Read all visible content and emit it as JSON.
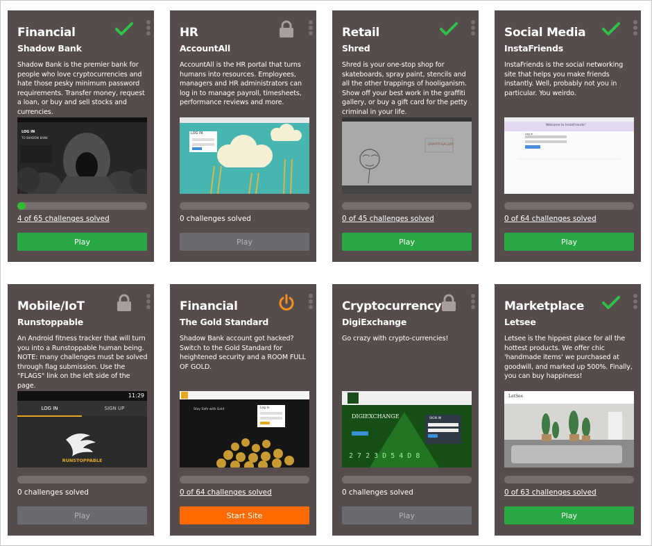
{
  "colors": {
    "card_bg": "#564c4c",
    "play": "#27a844",
    "disabled": "#6a6b70",
    "start": "#ff6a00",
    "check": "#2ec24a",
    "lock": "#a99e9e",
    "power": "#f5901e"
  },
  "cards": [
    {
      "category": "Financial",
      "name": "Shadow Bank",
      "description": "Shadow Bank is the premier bank for people who love cryptocurrencies and hate those pesky minimum password requirements. Transfer money, request a loan, or buy and sell stocks and currencies.",
      "status_icon": "check-icon",
      "progress": 0.06,
      "solved_text": "4 of 65 challenges solved",
      "button": "Play",
      "button_state": "play",
      "shot_caption": "LOG IN",
      "shot_sub": "TO SHADOW BANK"
    },
    {
      "category": "HR",
      "name": "AccountAll",
      "description": "AccountAll is the HR portal that turns humans into resources. Employees, managers and HR administrators can log in to manage payroll, timesheets, performance reviews and more.",
      "status_icon": "lock-icon",
      "progress": 0,
      "solved_text": "0 challenges solved",
      "button": "Play",
      "button_state": "disabled",
      "shot_caption": "LOG IN"
    },
    {
      "category": "Retail",
      "name": "Shred",
      "description": "Shred is your one-stop shop for skateboards, spray paint, stencils and all the other trappings of hooliganism. Show off your best work in the graffiti gallery, or buy a gift card for the petty criminal in your life.",
      "status_icon": "check-icon",
      "progress": 0,
      "solved_text": "0 of 45 challenges solved",
      "button": "Play",
      "button_state": "play",
      "shot_caption": "GRAFFITI GALLERY"
    },
    {
      "category": "Social Media",
      "name": "InstaFriends",
      "description": "InstaFriends is the social networking site that helps you make friends instantly. Well, probably not you in particular. You weirdo.",
      "status_icon": "check-icon",
      "progress": 0,
      "solved_text": "0 of 64 challenges solved",
      "button": "Play",
      "button_state": "play",
      "shot_caption": "Welcome to InstaFriends!",
      "shot_sub": "Log in"
    },
    {
      "category": "Mobile/IoT",
      "name": "Runstoppable",
      "description": "An Android fitness tracker that will turn you into a Runstoppable human being. NOTE: many challenges must be solved through flag submission. Use the \"FLAGS\" link on the left side of the page.",
      "status_icon": "lock-icon",
      "progress": 0,
      "solved_text": "0 challenges solved",
      "button": "Play",
      "button_state": "disabled",
      "shot_time": "11:29",
      "shot_tab1": "LOG IN",
      "shot_tab2": "SIGN UP",
      "shot_caption": "RUNSTOPPABLE"
    },
    {
      "category": "Financial",
      "name": "The Gold Standard",
      "description": "Shadow Bank account got hacked? Switch to the Gold Standard for heightened security and a ROOM FULL OF GOLD.",
      "status_icon": "power-icon",
      "progress": 0,
      "solved_text": "0 of 64 challenges solved",
      "button": "Start Site",
      "button_state": "start",
      "shot_caption": "Stay Safe with Gold",
      "shot_sub": "Log In"
    },
    {
      "category": "Cryptocurrency",
      "name": "DigiExchange",
      "description": "Go crazy with crypto-currencies!",
      "status_icon": "lock-icon",
      "progress": 0,
      "solved_text": "0 challenges solved",
      "button": "Play",
      "button_state": "disabled",
      "shot_caption": "DIGIEXCHANGE",
      "shot_sub": "SIGN IN",
      "shot_nums": "2 7 2 3 D 5 4 D 8"
    },
    {
      "category": "Marketplace",
      "name": "Letsee",
      "description": "Letsee is the hippest place for all the hottest products. We offer chic 'handmade items' we purchased at goodwill, and marked up 500%. Finally, you can buy happiness!",
      "status_icon": "check-icon",
      "progress": 0,
      "solved_text": "0 of 63 challenges solved",
      "button": "Play",
      "button_state": "play",
      "shot_caption": "LetSee"
    }
  ]
}
